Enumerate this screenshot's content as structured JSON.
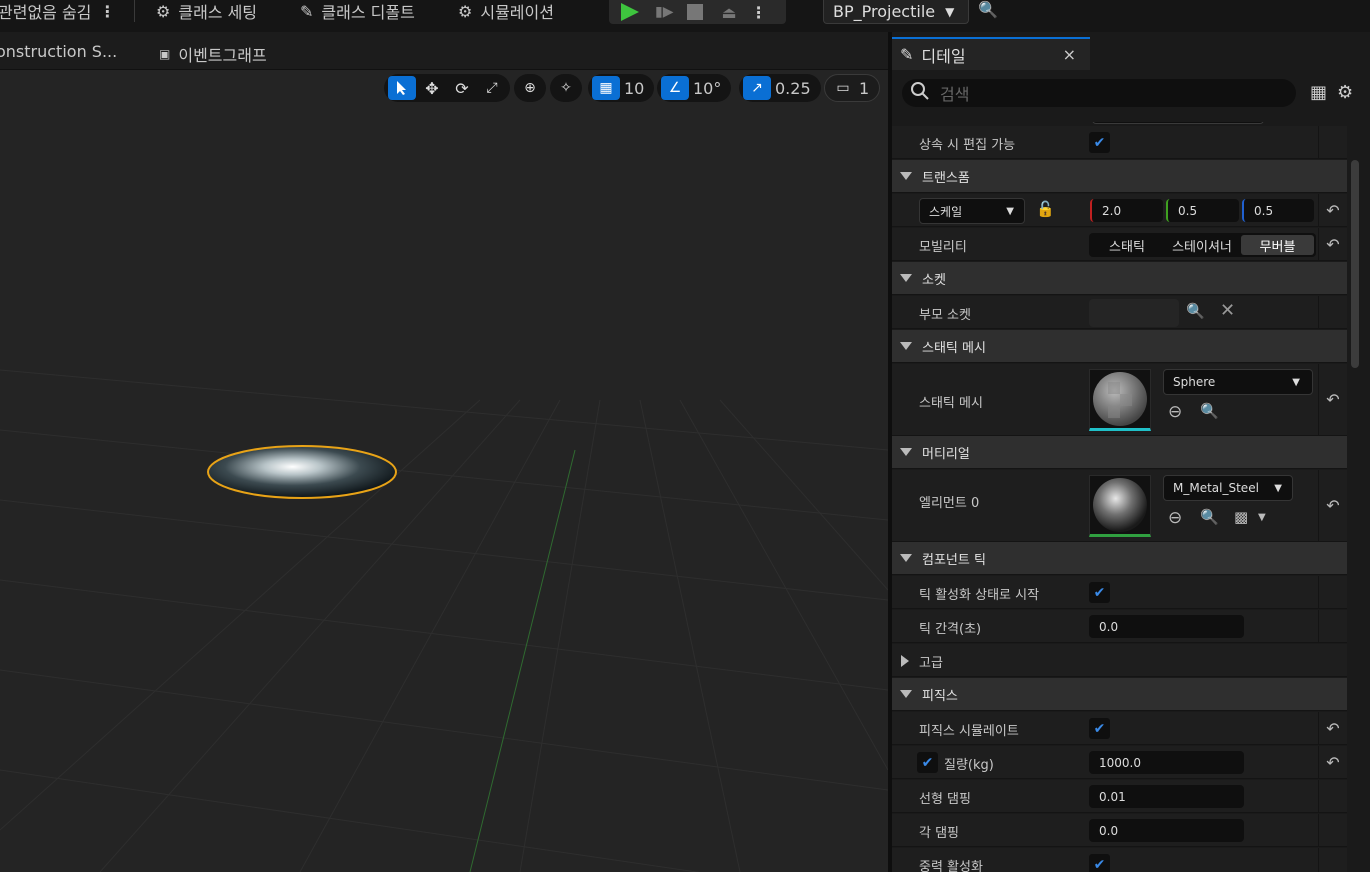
{
  "toolbar": {
    "hide_unrelated": "관련없음 숨김",
    "class_settings": "클래스 세팅",
    "class_defaults": "클래스 디폴트",
    "simulation": "시뮬레이션",
    "blueprint_name": "BP_Projectile"
  },
  "tabs": {
    "construction": "onstruction S...",
    "event_graph": "이벤트그래프"
  },
  "viewport": {
    "grid_snap": "10",
    "rotation_snap": "10°",
    "scale_snap": "0.25",
    "camera_speed": "1",
    "selection_color": "#e8a317"
  },
  "details": {
    "tab_title": "디테일",
    "close": "×",
    "search_placeholder": "검색",
    "editable_when_inherited": "상속 시 편집 가능",
    "transform": {
      "header": "트랜스폼",
      "scale_mode": "스케일",
      "scale": {
        "x": "2.0",
        "y": "0.5",
        "z": "0.5"
      },
      "mobility_label": "모빌리티",
      "mobility_options": [
        "스태틱",
        "스테이셔너",
        "무버블"
      ],
      "mobility_selected": "무버블"
    },
    "sockets": {
      "header": "소켓",
      "parent_socket": "부모 소켓",
      "parent_socket_value": ""
    },
    "static_mesh": {
      "header": "스태틱 메시",
      "label": "스태틱 메시",
      "value": "Sphere"
    },
    "materials": {
      "header": "머티리얼",
      "element_label": "엘리먼트 0",
      "value": "M_Metal_Steel"
    },
    "component_tick": {
      "header": "컴포넌트 틱",
      "start_with_tick": "틱 활성화 상태로 시작",
      "tick_interval_label": "틱 간격(초)",
      "tick_interval": "0.0",
      "advanced": "고급"
    },
    "physics": {
      "header": "피직스",
      "simulate": "피직스 시뮬레이트",
      "mass_label": "질량(kg)",
      "mass": "1000.0",
      "linear_damping_label": "선형 댐핑",
      "linear_damping": "0.01",
      "angular_damping_label": "각 댐핑",
      "angular_damping": "0.0",
      "enable_gravity": "중력 활성화"
    }
  },
  "colors": {
    "accent": "#0a6fd4",
    "play_green": "#3ec43e",
    "axis_x": "#c02020",
    "axis_y": "#3fa020",
    "axis_z": "#2060d0"
  }
}
